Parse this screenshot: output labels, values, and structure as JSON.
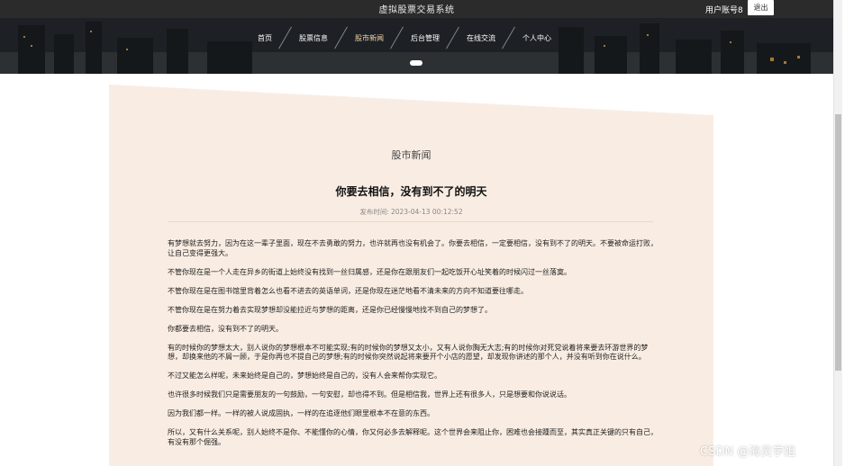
{
  "header": {
    "site_title": "虚拟股票交易系统",
    "user_label": "用户账号8",
    "logout_label": "退出"
  },
  "nav": {
    "items": [
      {
        "label": "首页"
      },
      {
        "label": "股票信息"
      },
      {
        "label": "股市新闻"
      },
      {
        "label": "后台管理"
      },
      {
        "label": "在线交流"
      },
      {
        "label": "个人中心"
      }
    ],
    "active_index": 2
  },
  "article": {
    "section_title": "股市新闻",
    "title": "你要去相信，没有到不了的明天",
    "publish_label": "发布时间:",
    "publish_time": "2023-04-13 00:12:52",
    "paragraphs": [
      "有梦想就去努力，因为在这一辈子里面，现在不去勇敢的努力，也许就再也没有机会了。你要去相信，一定要相信，没有到不了的明天。不要被命运打败，让自己变得更强大。",
      "不管你现在是一个人走在异乡的街道上始终没有找到一丝归属感，还是你在跟朋友们一起吃饭开心址笑着的时候闪过一丝落寞。",
      "不管你现在是在图书馆里背着怎么也看不进去的英语单词，还是你现在迷茫地看不清未来的方向不知道要往哪走。",
      "不管你现在是在努力着去实现梦想却没能拉近与梦想的距离，还是你已经慢慢地找不到自己的梦想了。",
      "你都要去相信，没有到不了的明天。",
      "有的时候你的梦想太大，别人说你的梦想根本不可能实现;有的时候你的梦想又太小，又有人说你胸无大志;有的时候你对死党说着将来要去环游世界的梦想，却换来他的不屑一顾，于是你再也不提自己的梦想;有的时候你突然说起将来要开个小店的愿望，却发现你讲述的那个人，并没有听到你在说什么。",
      "不过又能怎么样呢，未来始终是自己的，梦想始终是自己的，没有人会来帮你实现它。",
      "也许很多时候我们只是需要朋友的一句鼓励，一句安慰，却也得不到。但是相信我，世界上还有很多人，只是想要和你说说话。",
      "因为我们都一样。一样的被人说成固执，一样的在追逐他们眼里根本不在意的东西。",
      "所以，又有什么关系呢，别人始终不是你、不能懂你的心情，你又何必多去解释呢。这个世界会来阻止你，困难也会接踵而至，其实真正关键的只有自己，有没有那个倔强。"
    ]
  },
  "watermark": "CSDN @海灵学姐",
  "colors": {
    "topbar": "#2b2b2b",
    "panel": "#f9ede3",
    "nav_active": "#f5d5a8"
  }
}
